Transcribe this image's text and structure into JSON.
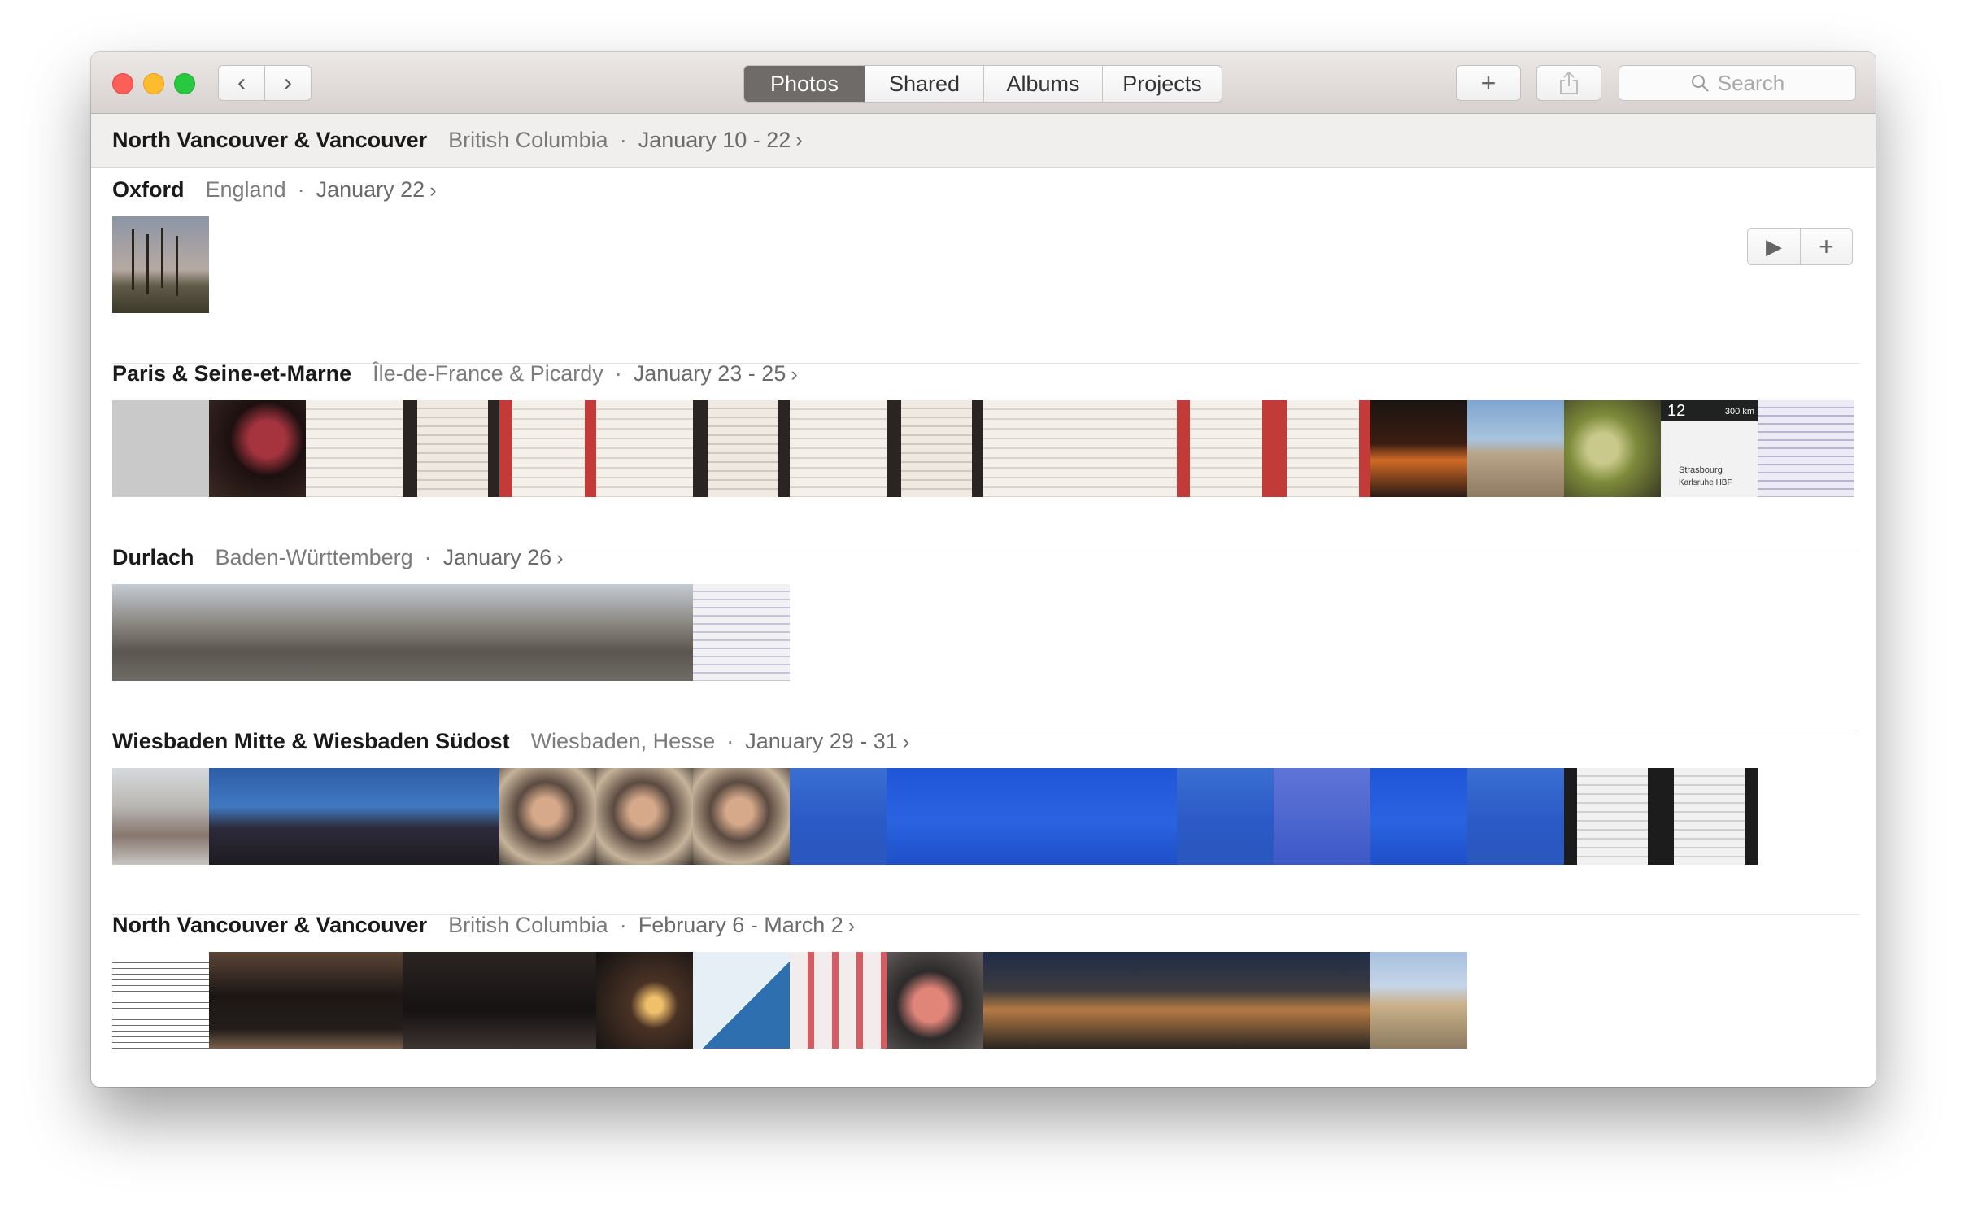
{
  "toolbar": {
    "back_icon": "‹",
    "forward_icon": "›",
    "tabs": [
      {
        "label": "Photos",
        "active": true
      },
      {
        "label": "Shared",
        "active": false
      },
      {
        "label": "Albums",
        "active": false
      },
      {
        "label": "Projects",
        "active": false
      }
    ],
    "add_icon": "+",
    "share_icon": "share-icon",
    "search": {
      "placeholder": "Search"
    }
  },
  "pinned_moment": {
    "title": "North Vancouver & Vancouver",
    "location": "British Columbia",
    "dates": "January 10 - 22"
  },
  "moments": [
    {
      "title": "Oxford",
      "location": "England",
      "dates": "January 22"
    },
    {
      "title": "Paris & Seine-et-Marne",
      "location": "Île-de-France & Picardy",
      "dates": "January 23 - 25"
    },
    {
      "title": "Durlach",
      "location": "Baden-Württemberg",
      "dates": "January 26"
    },
    {
      "title": "Wiesbaden Mitte & Wiesbaden Südost",
      "location": "Wiesbaden, Hesse",
      "dates": "January 29 - 31"
    },
    {
      "title": "North Vancouver & Vancouver",
      "location": "British Columbia",
      "dates": "February 6 - March 2"
    }
  ],
  "moment_actions": {
    "play_icon": "▶",
    "add_icon": "+"
  },
  "photo_counts": {
    "oxford": 1,
    "paris": 18,
    "durlach": 7,
    "wiesbaden": 17,
    "north_vancouver": 14
  },
  "ticket_text": {
    "time": "12",
    "note": "300 km",
    "city1": "Strasbourg",
    "city2": "Karlsruhe HBF"
  },
  "colors": {
    "active_tab": "#6e6b69",
    "close": "#fc5f57",
    "minimize": "#fdbc2e",
    "maximize": "#28c840"
  }
}
